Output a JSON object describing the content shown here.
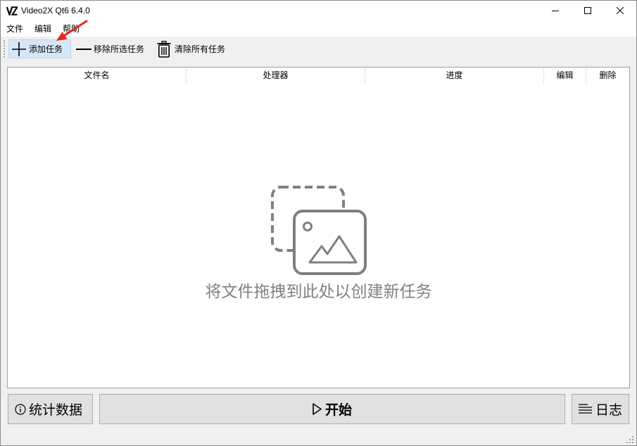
{
  "window": {
    "title": "Video2X Qt6 6.4.0",
    "icon": "video2x-logo-icon",
    "controls": {
      "minimize": "minimize-icon",
      "maximize": "maximize-icon",
      "close": "close-icon"
    }
  },
  "menu": {
    "items": [
      {
        "label": "文件"
      },
      {
        "label": "编辑"
      },
      {
        "label": "帮助"
      }
    ]
  },
  "toolbar": {
    "add": {
      "label": "添加任务",
      "icon": "plus-icon",
      "state": "hover"
    },
    "remove": {
      "label": "移除所选任务",
      "icon": "minus-icon"
    },
    "clear": {
      "label": "清除所有任务",
      "icon": "trash-icon"
    }
  },
  "table": {
    "columns": [
      "文件名",
      "处理器",
      "进度",
      "编辑",
      "删除"
    ],
    "rows": [],
    "empty": {
      "icon": "image-placeholder-icon",
      "message": "将文件拖拽到此处以创建新任务"
    }
  },
  "actions": {
    "stats": {
      "label": "统计数据",
      "icon": "info-icon"
    },
    "start": {
      "label": "开始",
      "icon": "play-icon"
    },
    "log": {
      "label": "日志",
      "icon": "log-lines-icon"
    }
  },
  "annotation": {
    "icon": "red-arrow-icon"
  },
  "colors": {
    "window_bg": "#f0f0f0",
    "accent_hover": "#d5e7f8",
    "placeholder_gray": "#808080",
    "annotation_red": "#e8271c"
  }
}
